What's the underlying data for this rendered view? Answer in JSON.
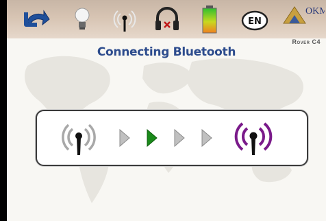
{
  "toolbar": {
    "items": [
      {
        "name": "back-arrow-icon"
      },
      {
        "name": "lightbulb-icon"
      },
      {
        "name": "antenna-icon"
      },
      {
        "name": "headphones-icon"
      },
      {
        "name": "battery-icon"
      },
      {
        "name": "language-icon"
      },
      {
        "name": "logo"
      }
    ],
    "language": "EN",
    "brand": "OKM",
    "colors": {
      "toolbar_bg": "#d7c4b3",
      "battery_top": "#2fbf2f",
      "battery_bottom": "#f08020"
    }
  },
  "main": {
    "title": "Connecting Bluetooth",
    "model": "Rover C4"
  },
  "connection": {
    "source": "antenna-grey-icon",
    "target": "antenna-purple-icon",
    "steps": [
      "inactive",
      "active",
      "inactive",
      "inactive"
    ],
    "colors": {
      "active": "#1a8a1a",
      "inactive": "#a8a8a8",
      "target": "#7a1a8a"
    }
  }
}
